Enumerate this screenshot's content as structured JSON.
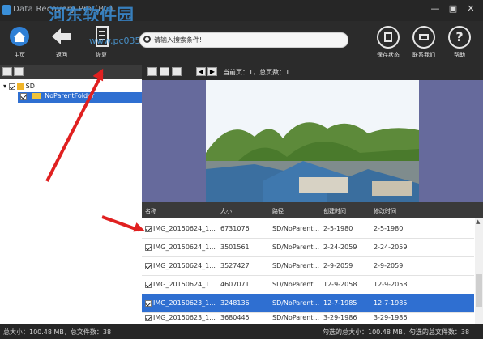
{
  "titlebar": {
    "title": "Data Recovery Pro  (BC)",
    "watermark": "河东软件园",
    "watermark_url": "www.pc0359.cn"
  },
  "toolbar": {
    "home_label": "主页",
    "back_label": "返回",
    "recover_label": "恢复",
    "save_state_label": "保存状态",
    "contact_label": "联系我们",
    "help_label": "帮助"
  },
  "search": {
    "placeholder": "请输入搜索条件!"
  },
  "tree": {
    "root": "SD",
    "child": "NoParentFolder"
  },
  "pager": {
    "text": "当前页：1，总页数：1"
  },
  "table": {
    "headers": [
      "名称",
      "大小",
      "路径",
      "创建时间",
      "修改时间"
    ],
    "rows": [
      {
        "name": "IMG_20150624_1...",
        "size": "6731076",
        "path": "SD/NoParent...",
        "created": "2-5-1980",
        "modified": "2-5-1980"
      },
      {
        "name": "IMG_20150624_1...",
        "size": "3501561",
        "path": "SD/NoParent...",
        "created": "2-24-2059",
        "modified": "2-24-2059"
      },
      {
        "name": "IMG_20150624_1...",
        "size": "3527427",
        "path": "SD/NoParent...",
        "created": "2-9-2059",
        "modified": "2-9-2059"
      },
      {
        "name": "IMG_20150624_1...",
        "size": "4607071",
        "path": "SD/NoParent...",
        "created": "12-9-2058",
        "modified": "12-9-2058"
      },
      {
        "name": "IMG_20150623_1...",
        "size": "3248136",
        "path": "SD/NoParent...",
        "created": "12-7-1985",
        "modified": "12-7-1985"
      },
      {
        "name": "IMG_20150623_1...",
        "size": "3680445",
        "path": "SD/NoParent...",
        "created": "3-29-1986",
        "modified": "3-29-1986"
      }
    ]
  },
  "status": {
    "left": "总大小：100.48 MB，总文件数：38",
    "right": "勾选的总大小：100.48 MB，勾选的总文件数：38"
  },
  "colors": {
    "selection": "#2f6fd1",
    "arrow": "#e02020",
    "dark": "#2b2b2b"
  }
}
